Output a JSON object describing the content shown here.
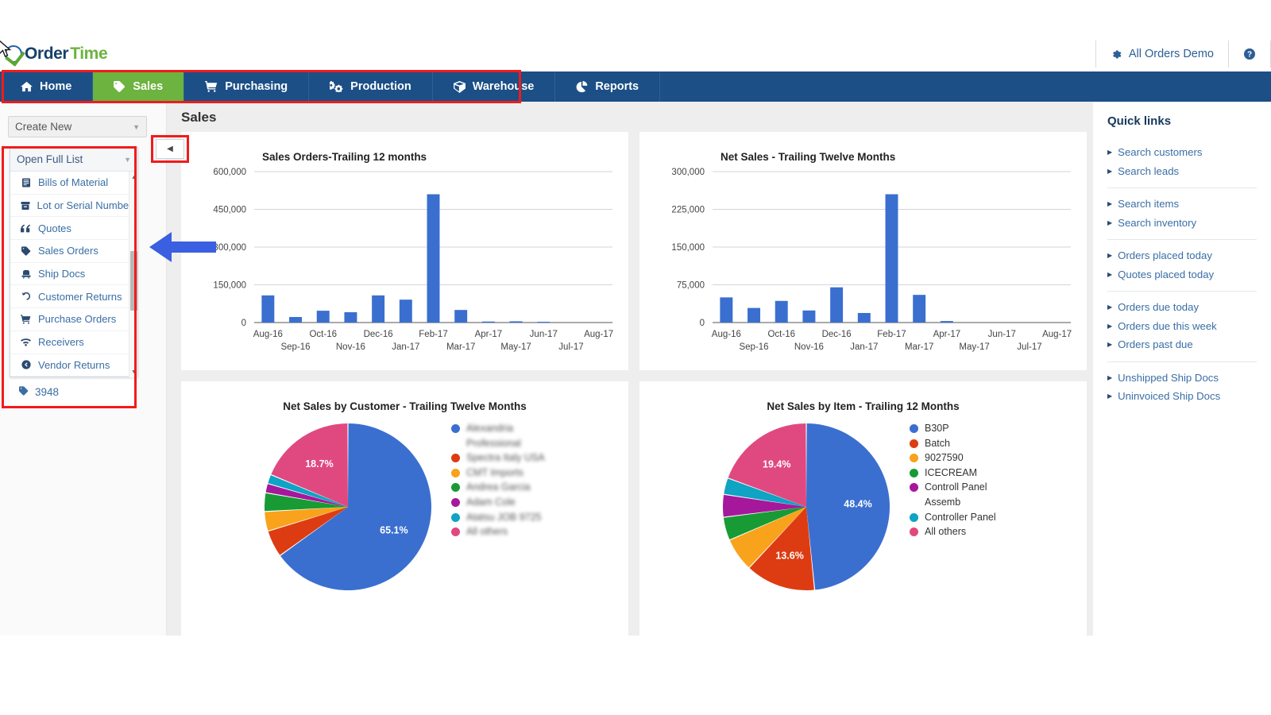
{
  "brand": {
    "name_part1": "Order",
    "name_part2": "Time",
    "mark": "check-circle-icon"
  },
  "header": {
    "account_label": "All Orders Demo",
    "gear_icon": "gear-icon",
    "help_icon": "help-circle-icon"
  },
  "nav": {
    "items": [
      {
        "label": "Home",
        "icon": "home-icon",
        "active": false
      },
      {
        "label": "Sales",
        "icon": "tag-icon",
        "active": true
      },
      {
        "label": "Purchasing",
        "icon": "cart-icon",
        "active": false
      },
      {
        "label": "Production",
        "icon": "gears-icon",
        "active": false
      },
      {
        "label": "Warehouse",
        "icon": "box-icon",
        "active": false
      },
      {
        "label": "Reports",
        "icon": "pie-chart-icon",
        "active": false
      }
    ]
  },
  "sidebar": {
    "create_new_label": "Create New",
    "create_new_caret": "▼",
    "list_header": "Open Full List",
    "list_header_caret": "▼",
    "items": [
      {
        "label": "Bills of Material",
        "icon": "document-list-icon"
      },
      {
        "label": "Lot or Serial Numbers",
        "icon": "archive-icon"
      },
      {
        "label": "Quotes",
        "icon": "quote-icon"
      },
      {
        "label": "Sales Orders",
        "icon": "tag-icon"
      },
      {
        "label": "Ship Docs",
        "icon": "truck-icon"
      },
      {
        "label": "Customer Returns",
        "icon": "undo-icon"
      },
      {
        "label": "Purchase Orders",
        "icon": "cart-icon"
      },
      {
        "label": "Receivers",
        "icon": "signal-icon"
      },
      {
        "label": "Vendor Returns",
        "icon": "back-arrow-circle-icon"
      }
    ],
    "footer_item": {
      "label": "3948",
      "icon": "tag-icon"
    },
    "collapse_caret": "◀",
    "scroll_up": "▲",
    "scroll_down": "▼"
  },
  "main": {
    "page_title": "Sales"
  },
  "quick_links": {
    "title": "Quick links",
    "bullet": "▶",
    "groups": [
      [
        "Search customers",
        "Search leads"
      ],
      [
        "Search items",
        "Search inventory"
      ],
      [
        "Orders placed today",
        "Quotes placed today"
      ],
      [
        "Orders due today",
        "Orders due this week",
        "Orders past due"
      ],
      [
        "Unshipped Ship Docs",
        "Uninvoiced Ship Docs"
      ]
    ]
  },
  "chart_data": [
    {
      "type": "bar",
      "title": "Sales Orders-Trailing 12 months",
      "xlabel": "",
      "ylabel": "",
      "categories": [
        "Aug-16",
        "Sep-16",
        "Oct-16",
        "Nov-16",
        "Dec-16",
        "Jan-17",
        "Feb-17",
        "Mar-17",
        "Apr-17",
        "May-17",
        "Jun-17",
        "Jul-17",
        "Aug-17"
      ],
      "values": [
        108000,
        22000,
        47000,
        41000,
        108000,
        91000,
        510000,
        50000,
        4000,
        5000,
        3000,
        0,
        0
      ],
      "ylim": [
        0,
        600000
      ],
      "yticks": [
        0,
        150000,
        300000,
        450000,
        600000
      ],
      "ytick_labels": [
        "0",
        "150,000",
        "300,000",
        "450,000",
        "600,000"
      ],
      "grid": true,
      "legend": "none",
      "bar_color": "#3a6fd0"
    },
    {
      "type": "bar",
      "title": "Net Sales - Trailing Twelve Months",
      "xlabel": "",
      "ylabel": "",
      "categories": [
        "Aug-16",
        "Sep-16",
        "Oct-16",
        "Nov-16",
        "Dec-16",
        "Jan-17",
        "Feb-17",
        "Mar-17",
        "Apr-17",
        "May-17",
        "Jun-17",
        "Jul-17",
        "Aug-17"
      ],
      "values": [
        50000,
        29000,
        43000,
        24000,
        70000,
        19000,
        255000,
        55000,
        3000,
        0,
        0,
        0,
        0
      ],
      "ylim": [
        0,
        300000
      ],
      "yticks": [
        0,
        75000,
        150000,
        225000,
        300000
      ],
      "ytick_labels": [
        "0",
        "75,000",
        "150,000",
        "225,000",
        "300,000"
      ],
      "grid": true,
      "legend": "none",
      "bar_color": "#3a6fd0"
    },
    {
      "type": "pie",
      "title": "Net Sales by Customer - Trailing Twelve Months",
      "legend_position": "right",
      "legend_blurred": true,
      "labels": [
        "Alexandria\nProfessional",
        "Spectra Italy USA",
        "CMT Imports",
        "Andrea Garcia",
        "Adam Cole",
        "Atatsu JOB 9725",
        "All others"
      ],
      "values": [
        65.1,
        5.2,
        3.8,
        3.6,
        1.8,
        1.8,
        18.7
      ],
      "visible_slice_labels": [
        {
          "label": "65.1%",
          "value": 65.1
        },
        {
          "label": "18.7%",
          "value": 18.7
        }
      ],
      "colors": [
        "#3a6fd0",
        "#dd3c12",
        "#f9a21b",
        "#189b34",
        "#a6189b",
        "#0fa3c4",
        "#e0497f"
      ]
    },
    {
      "type": "pie",
      "title": "Net Sales by Item - Trailing 12 Months",
      "legend_position": "right",
      "legend_blurred": false,
      "labels": [
        "B30P",
        "Batch",
        "9027590",
        "ICECREAM",
        "Controll Panel\nAssemb",
        "Controller Panel",
        "All others"
      ],
      "values": [
        48.4,
        13.6,
        6.5,
        4.5,
        4.4,
        3.2,
        19.4
      ],
      "visible_slice_labels": [
        {
          "label": "48.4%",
          "value": 48.4
        },
        {
          "label": "13.6%",
          "value": 13.6
        },
        {
          "label": "19.4%",
          "value": 19.4
        }
      ],
      "colors": [
        "#3a6fd0",
        "#dd3c12",
        "#f9a21b",
        "#189b34",
        "#a6189b",
        "#0fa3c4",
        "#e0497f"
      ]
    }
  ],
  "annotations": {
    "box_color": "#f11b1b",
    "arrow_color": "#3a5fe0"
  }
}
